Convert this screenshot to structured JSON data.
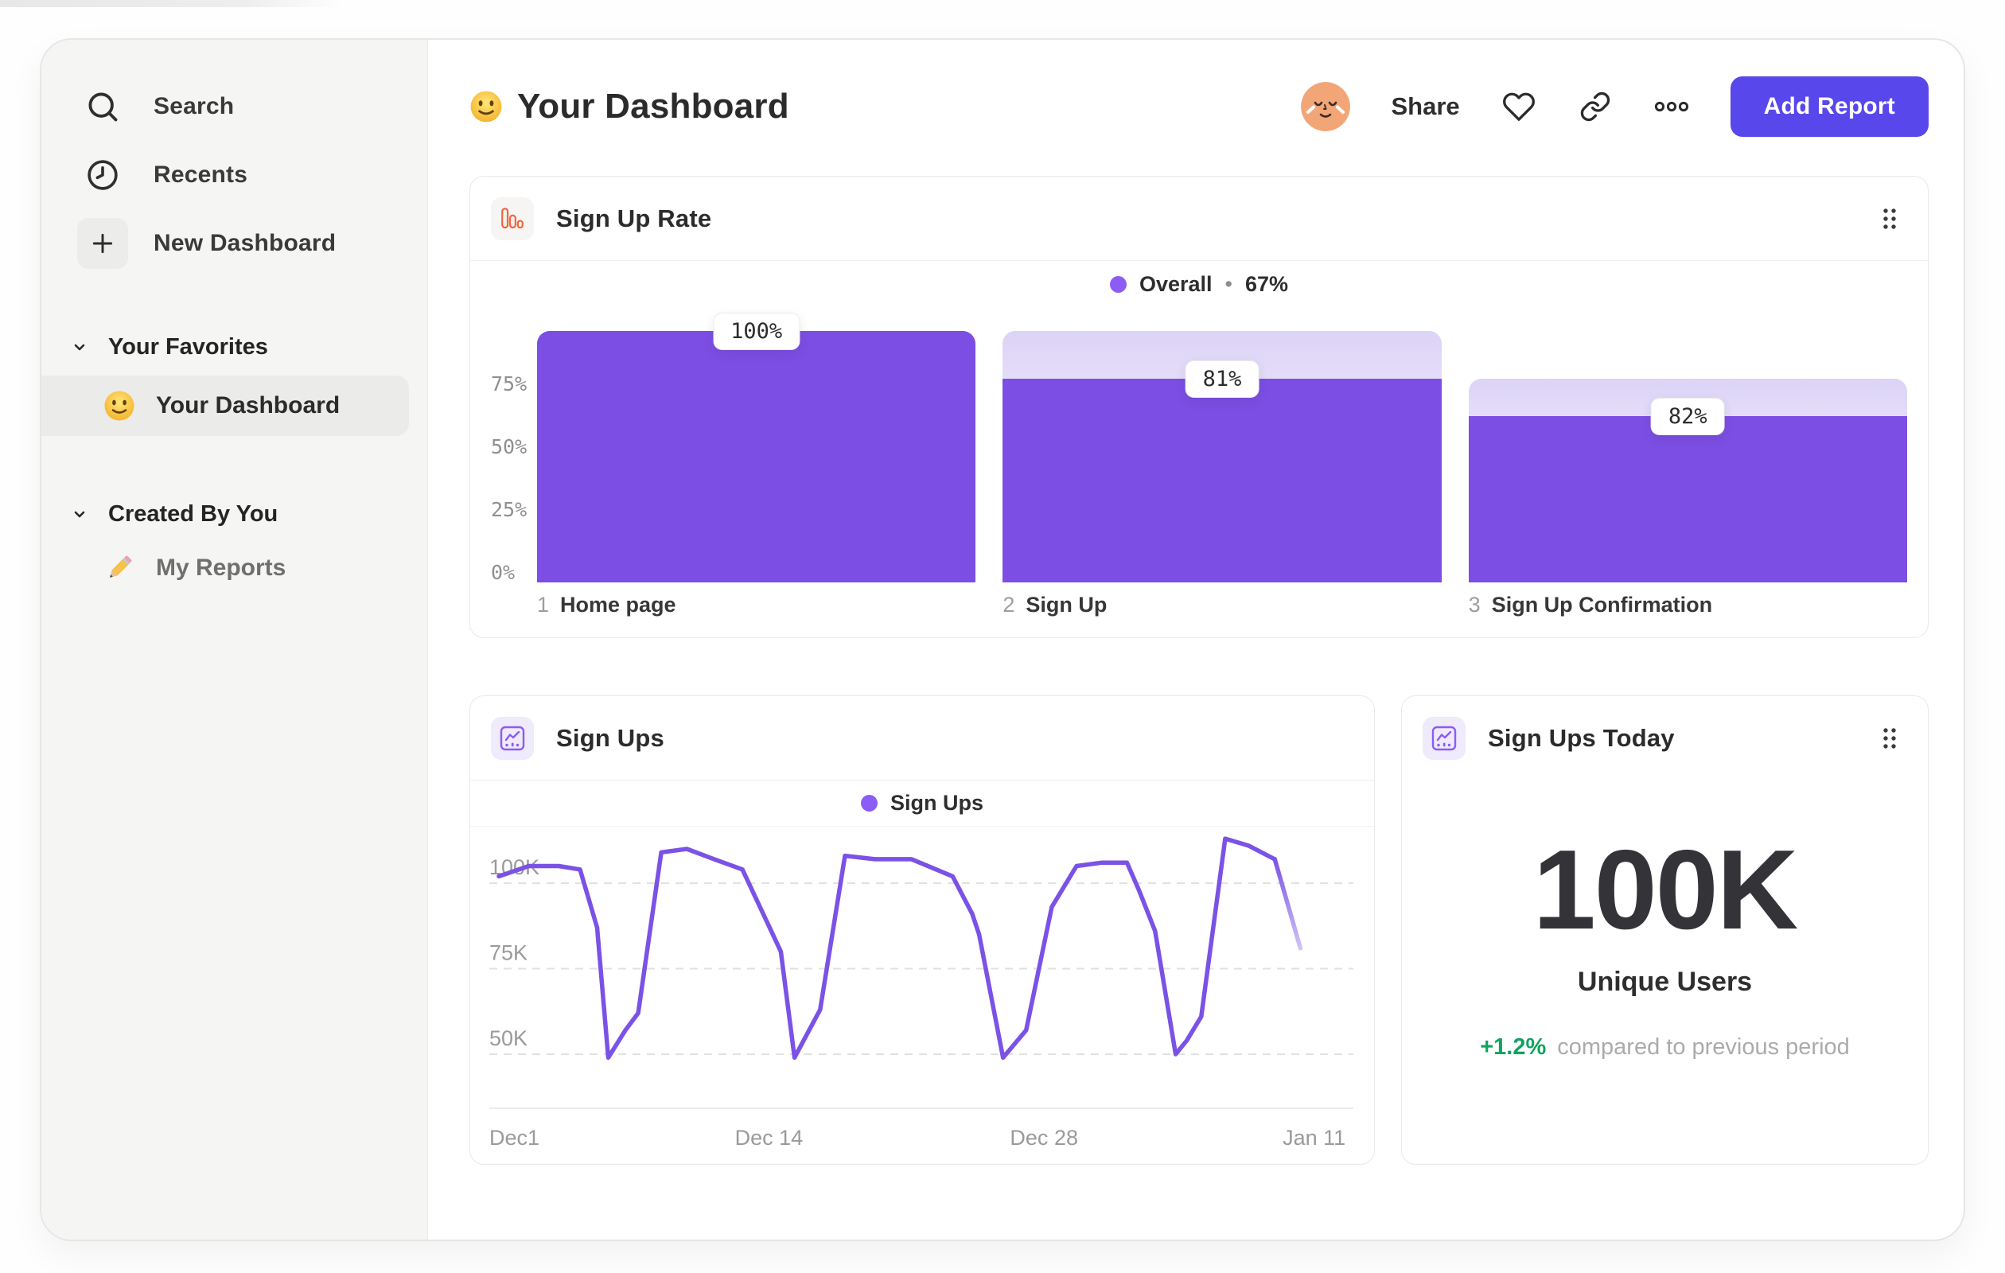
{
  "colors": {
    "accent": "#5847eb",
    "bar_purple": "#7c4ee4",
    "line_purple": "#7b52e6",
    "line_fade": "#cfc3f7",
    "legend_dot": "#8b5cf6",
    "icon_orange": "#f4643c",
    "icon_purple": "#8b5cf6",
    "delta_green": "#0ea35e",
    "sidebar_bg": "#f5f5f3"
  },
  "sidebar": {
    "items": [
      {
        "label": "Search",
        "icon": "search-icon"
      },
      {
        "label": "Recents",
        "icon": "clock-icon"
      },
      {
        "label": "New Dashboard",
        "icon": "plus-icon"
      }
    ],
    "sections": [
      {
        "label": "Your Favorites",
        "items": [
          {
            "label": "Your Dashboard",
            "icon": "smiley-emoji",
            "selected": true
          }
        ]
      },
      {
        "label": "Created By You",
        "items": [
          {
            "label": "My Reports",
            "icon": "pencil-emoji",
            "selected": false
          }
        ]
      }
    ]
  },
  "header": {
    "title": "Your Dashboard",
    "title_emoji": "slightly-smiling-face",
    "share_label": "Share",
    "add_report_label": "Add Report"
  },
  "chart_data": [
    {
      "id": "sign-up-rate",
      "type": "bar",
      "title": "Sign Up Rate",
      "legend": {
        "label": "Overall",
        "separator": "•",
        "value": "67%"
      },
      "ylim": [
        0,
        100
      ],
      "y_ticks": [
        "75%",
        "50%",
        "25%",
        "0%"
      ],
      "y_tick_values": [
        75,
        50,
        25,
        0
      ],
      "steps": [
        {
          "index": "1",
          "label": "Home page",
          "pct": 100,
          "prev_pct": 100,
          "tooltip": "100%"
        },
        {
          "index": "2",
          "label": "Sign Up",
          "pct": 81,
          "prev_pct": 100,
          "tooltip": "81%"
        },
        {
          "index": "3",
          "label": "Sign Up Confirmation",
          "pct": 66,
          "prev_pct": 81,
          "tooltip": "82%"
        }
      ]
    },
    {
      "id": "sign-ups",
      "type": "line",
      "title": "Sign Ups",
      "legend": {
        "label": "Sign Ups"
      },
      "unit": "K",
      "ylim": [
        35,
        115
      ],
      "y_gridlines": [
        100,
        75,
        50
      ],
      "y_tick_labels": [
        "100K",
        "75K",
        "50K"
      ],
      "x_ticks": [
        {
          "label": "Dec1",
          "frac": 0.0,
          "anchor": "start"
        },
        {
          "label": "Dec 14",
          "frac": 0.316,
          "anchor": "middle"
        },
        {
          "label": "Dec 28",
          "frac": 0.638,
          "anchor": "middle"
        },
        {
          "label": "Jan 11",
          "frac": 0.954,
          "anchor": "middle"
        }
      ],
      "points": [
        [
          0.0,
          102
        ],
        [
          0.035,
          105
        ],
        [
          0.07,
          105
        ],
        [
          0.095,
          104
        ],
        [
          0.115,
          87
        ],
        [
          0.128,
          49
        ],
        [
          0.148,
          57
        ],
        [
          0.163,
          62
        ],
        [
          0.19,
          109
        ],
        [
          0.22,
          110
        ],
        [
          0.252,
          107
        ],
        [
          0.285,
          104
        ],
        [
          0.315,
          88
        ],
        [
          0.33,
          80
        ],
        [
          0.346,
          49
        ],
        [
          0.363,
          57
        ],
        [
          0.376,
          63
        ],
        [
          0.405,
          108
        ],
        [
          0.44,
          107
        ],
        [
          0.483,
          107
        ],
        [
          0.531,
          102
        ],
        [
          0.554,
          91
        ],
        [
          0.562,
          85
        ],
        [
          0.59,
          49
        ],
        [
          0.617,
          57
        ],
        [
          0.647,
          93
        ],
        [
          0.676,
          105
        ],
        [
          0.706,
          106
        ],
        [
          0.735,
          106
        ],
        [
          0.749,
          98
        ],
        [
          0.768,
          86
        ],
        [
          0.792,
          50
        ],
        [
          0.805,
          54
        ],
        [
          0.822,
          61
        ],
        [
          0.85,
          113
        ],
        [
          0.877,
          111
        ],
        [
          0.908,
          107
        ],
        [
          0.938,
          81
        ]
      ],
      "fade_from_index": 36
    },
    {
      "id": "sign-ups-today",
      "type": "big-number",
      "title": "Sign Ups Today",
      "value": "100K",
      "label": "Unique Users",
      "delta": "+1.2%",
      "delta_note": "compared to previous period"
    }
  ]
}
